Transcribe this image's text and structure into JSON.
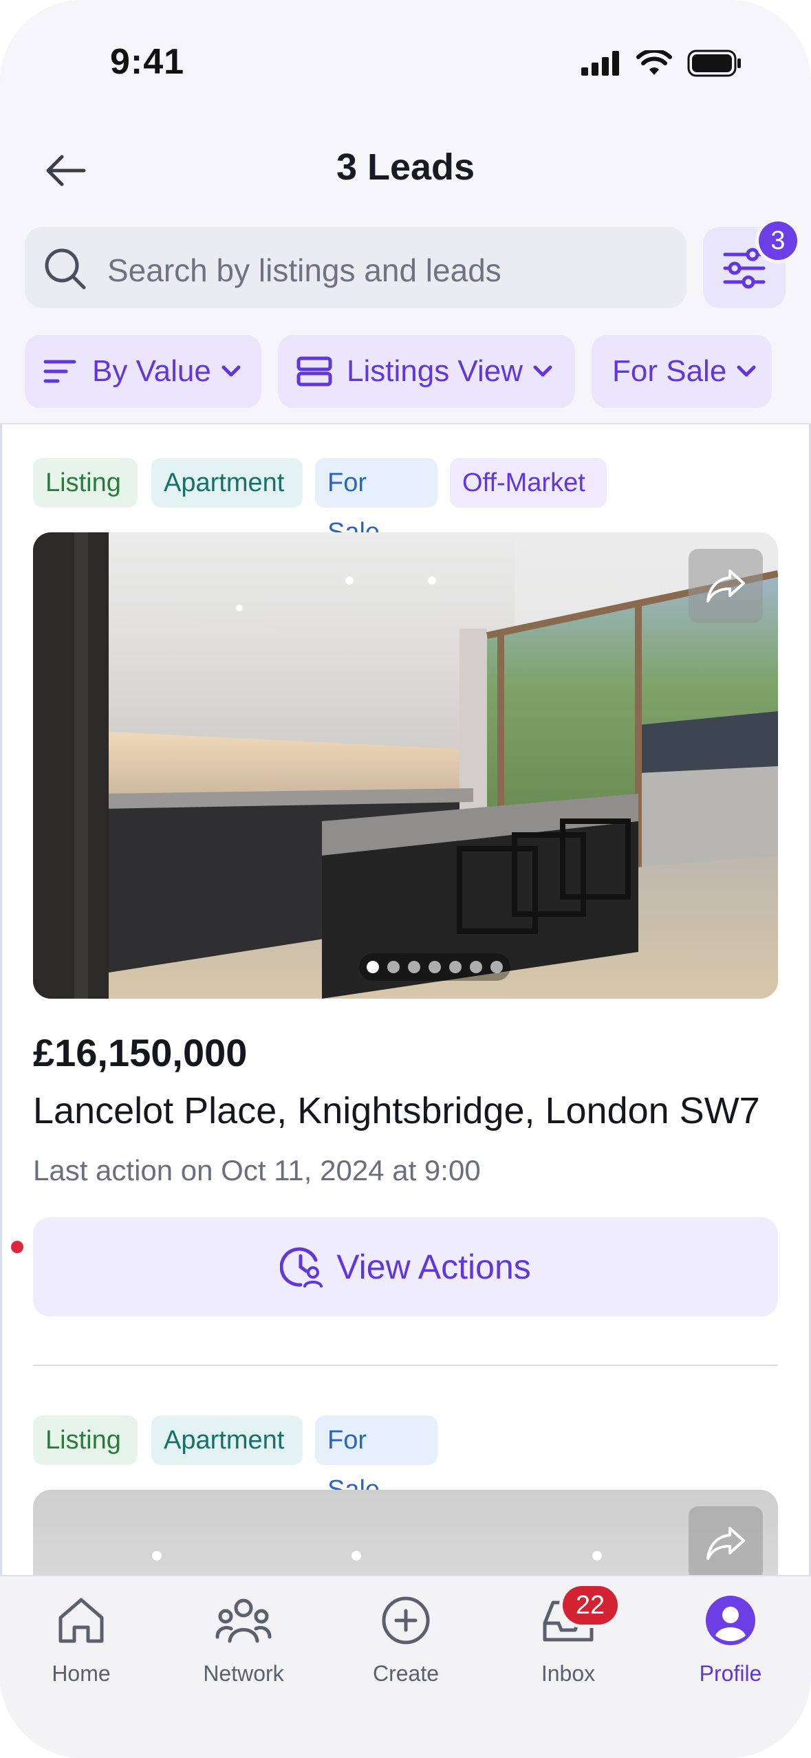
{
  "status_bar": {
    "time": "9:41"
  },
  "header": {
    "title": "3 Leads",
    "search_placeholder": "Search by listings and leads",
    "filter_count": "3"
  },
  "filters": {
    "sort": "By Value",
    "view": "Listings View",
    "status": "For Sale"
  },
  "listings": [
    {
      "tags": [
        "Listing",
        "Apartment",
        "For Sale",
        "Off-Market"
      ],
      "price": "£16,150,000",
      "address": "Lancelot Place, Knightsbridge, London SW7",
      "last_action": "Last action on Oct 11, 2024 at  9:00",
      "photo_count": 7,
      "active_photo": 1,
      "view_actions_label": "View Actions"
    },
    {
      "tags": [
        "Listing",
        "Apartment",
        "For Sale"
      ]
    }
  ],
  "tab_bar": {
    "items": [
      {
        "label": "Home",
        "icon": "home-icon"
      },
      {
        "label": "Network",
        "icon": "network-icon"
      },
      {
        "label": "Create",
        "icon": "plus-circle-icon"
      },
      {
        "label": "Inbox",
        "icon": "inbox-icon",
        "badge": "22"
      },
      {
        "label": "Profile",
        "icon": "profile-icon",
        "active": true
      }
    ]
  },
  "colors": {
    "accent": "#6236dd",
    "tag_listing_bg": "#e6f4ea",
    "tag_listing_fg": "#2c7a3f",
    "tag_apartment_bg": "#e2f3f1",
    "tag_apartment_fg": "#17706a",
    "tag_forsale_bg": "#e6f0fb",
    "tag_forsale_fg": "#2a65c2",
    "tag_offmarket_bg": "#efeafd",
    "tag_offmarket_fg": "#6236dd",
    "badge_red": "#d32232"
  }
}
